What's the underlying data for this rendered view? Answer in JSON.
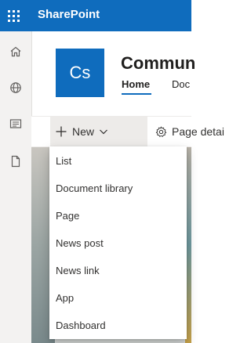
{
  "suite_bar": {
    "app_name": "SharePoint",
    "waffle_icon": "app-launcher-icon",
    "brand_color": "#0f6cbd"
  },
  "left_rail": {
    "items": [
      {
        "name": "home-icon"
      },
      {
        "name": "globe-icon"
      },
      {
        "name": "news-icon"
      },
      {
        "name": "document-icon"
      }
    ]
  },
  "site": {
    "logo_initials": "Cs",
    "title": "Commun",
    "nav": [
      {
        "label": "Home",
        "selected": true
      },
      {
        "label": "Doc"
      }
    ]
  },
  "command_bar": {
    "new_label": "New",
    "page_details_label": "Page detai"
  },
  "new_menu": {
    "items": [
      {
        "label": "List"
      },
      {
        "label": "Document library"
      },
      {
        "label": "Page"
      },
      {
        "label": "News post"
      },
      {
        "label": "News link"
      },
      {
        "label": "App"
      },
      {
        "label": "Dashboard"
      }
    ]
  }
}
